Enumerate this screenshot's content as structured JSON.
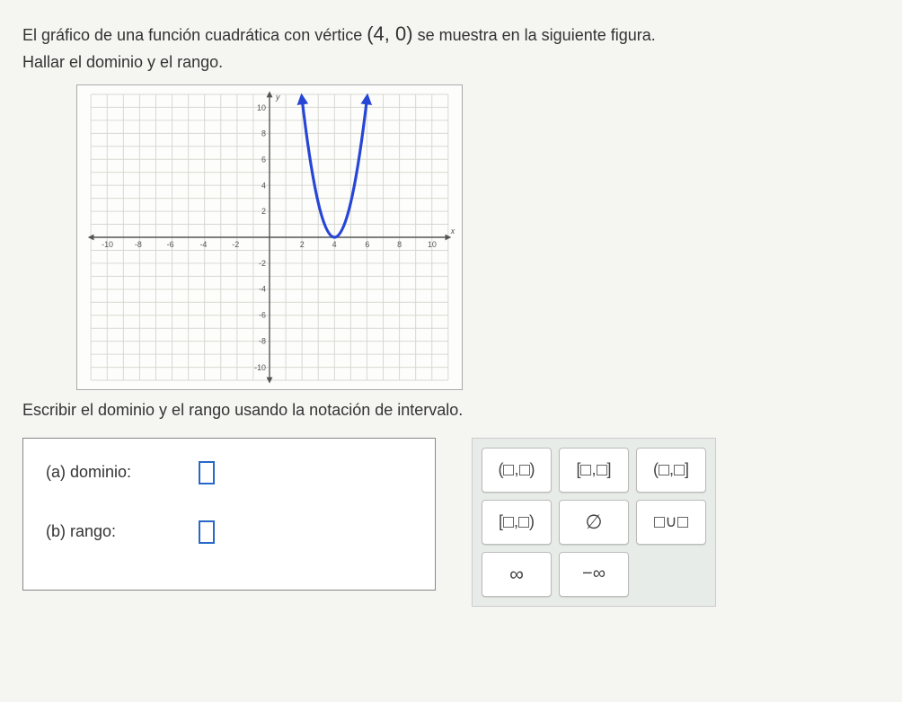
{
  "question": {
    "line1_pre": "El gráfico de una función cuadrática con vértice ",
    "vertex": "(4, 0)",
    "line1_post": " se muestra en la siguiente figura.",
    "line2": "Hallar el dominio y el rango."
  },
  "instruction": "Escribir el dominio y el rango usando la notación de intervalo.",
  "answers": {
    "a_label": "(a)  dominio:",
    "b_label": "(b)  rango:"
  },
  "keypad": {
    "open_open": "(□,□)",
    "closed_closed": "[□,□]",
    "open_closed": "(□,□]",
    "closed_open": "[□,□)",
    "empty_set": "∅",
    "union": "□∪□",
    "infinity": "∞",
    "neg_infinity": "−∞"
  },
  "chart_data": {
    "type": "line",
    "title": "",
    "xlabel": "x",
    "ylabel": "y",
    "xlim": [
      -10,
      10
    ],
    "ylim": [
      -10,
      10
    ],
    "x_ticks": [
      -10,
      -8,
      -6,
      -4,
      -2,
      2,
      4,
      6,
      8,
      10
    ],
    "y_ticks": [
      -10,
      -8,
      -6,
      -4,
      -2,
      2,
      4,
      6,
      8,
      10
    ],
    "vertex": [
      4,
      0
    ],
    "description": "Upward parabola with vertex (4,0)",
    "series": [
      {
        "name": "parabola",
        "x": [
          2,
          2.5,
          3,
          3.5,
          4,
          4.5,
          5,
          5.5,
          6
        ],
        "y": [
          10,
          5.625,
          2.5,
          0.625,
          0,
          0.625,
          2.5,
          5.625,
          10
        ]
      }
    ]
  }
}
